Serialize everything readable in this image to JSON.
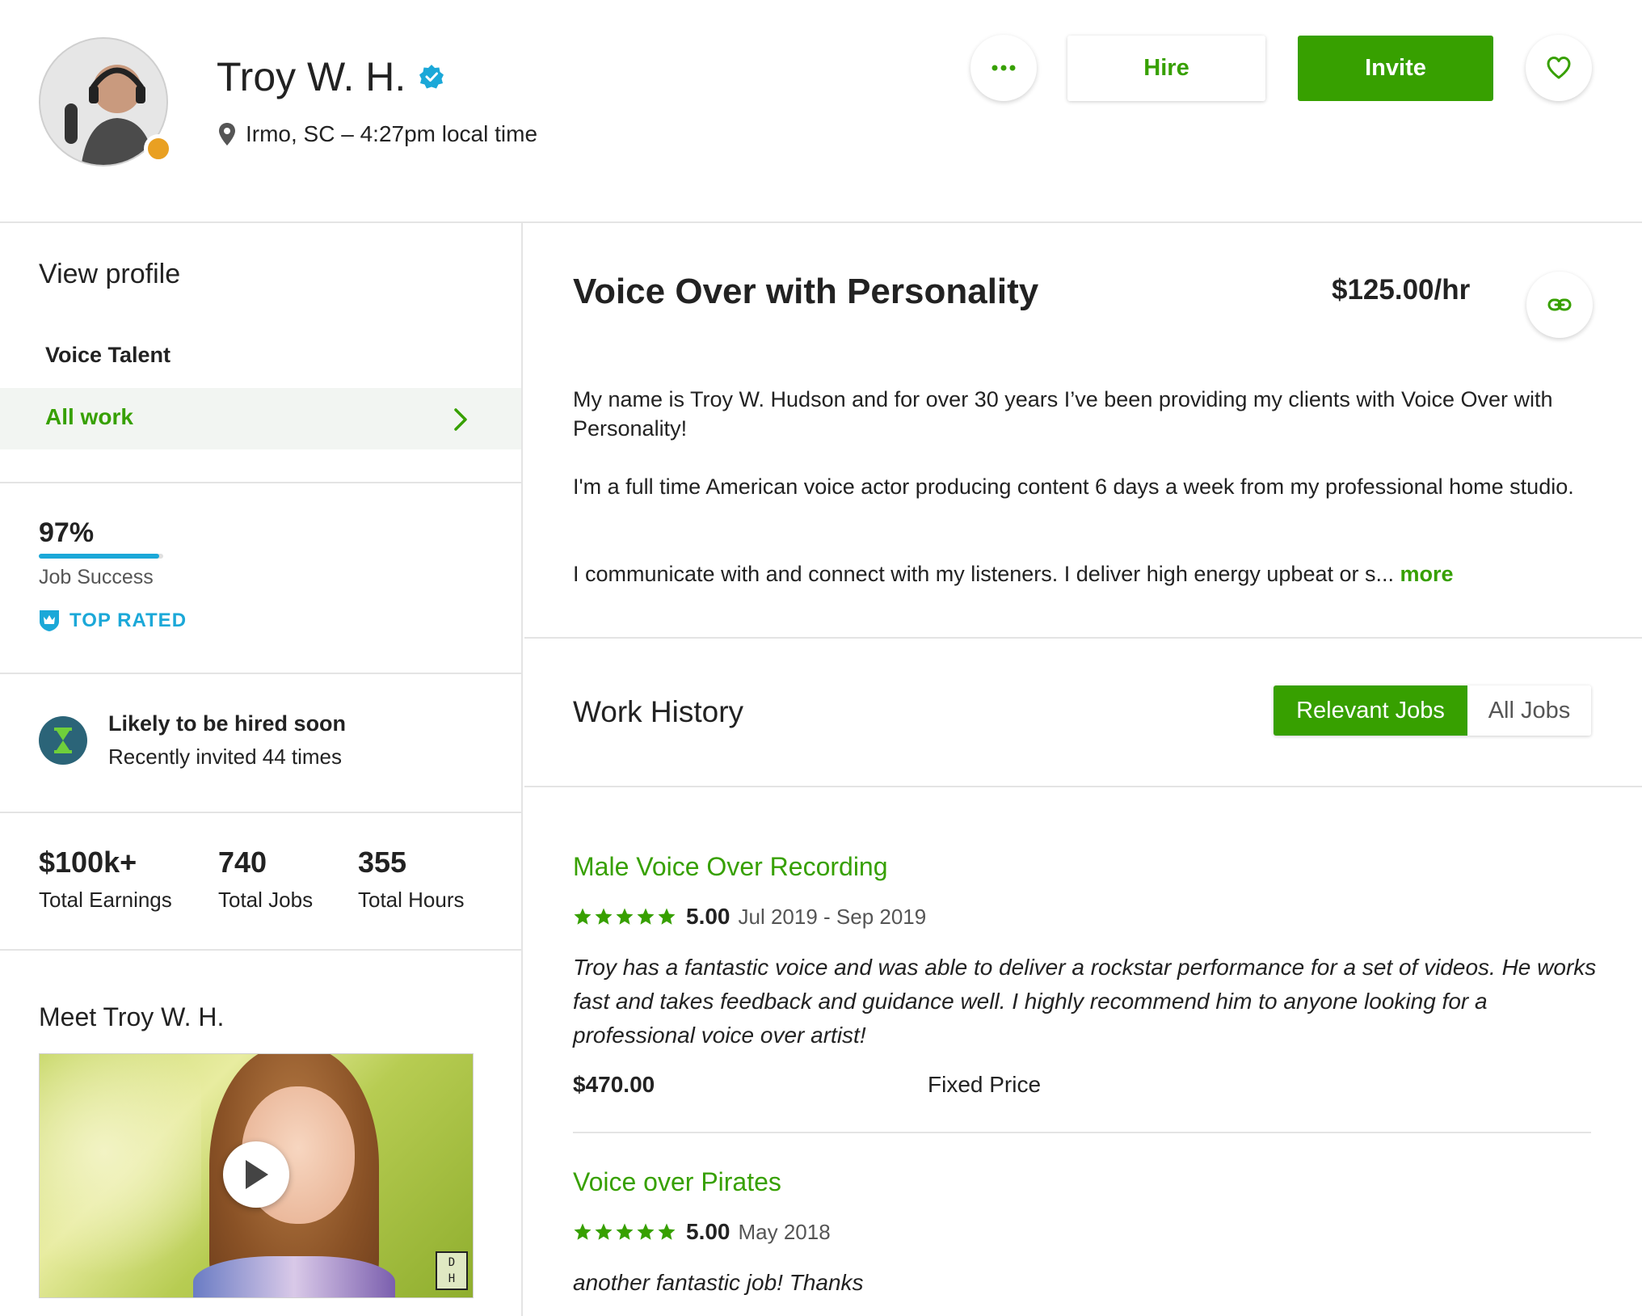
{
  "header": {
    "name": "Troy W. H.",
    "location": "Irmo, SC – 4:27pm local time",
    "hire_label": "Hire",
    "invite_label": "Invite"
  },
  "sidebar": {
    "view_profile": "View profile",
    "category": "Voice Talent",
    "all_work": "All work",
    "job_success_pct": "97%",
    "job_success_value": 0.97,
    "job_success_label": "Job Success",
    "top_rated": "TOP RATED",
    "likely_title": "Likely to be hired soon",
    "likely_sub": "Recently invited 44 times",
    "stats": [
      {
        "value": "$100k+",
        "label": "Total Earnings"
      },
      {
        "value": "740",
        "label": "Total Jobs"
      },
      {
        "value": "355",
        "label": "Total Hours"
      }
    ],
    "meet": "Meet Troy W. H.",
    "video_badge_top": "D",
    "video_badge_bottom": "H"
  },
  "main": {
    "title": "Voice Over with Personality",
    "rate": "$125.00/hr",
    "overview": [
      "My name is Troy W. Hudson and for over 30 years I’ve been providing my clients with Voice Over with Personality!",
      "I'm a full time American voice actor producing content 6 days a week from my professional home studio.",
      "I communicate with and connect with my listeners. I deliver high energy upbeat or s..."
    ],
    "more_label": "more",
    "work_history_title": "Work History",
    "tab_relevant": "Relevant Jobs",
    "tab_all": "All Jobs",
    "jobs": [
      {
        "title": "Male Voice Over Recording",
        "score": "5.00",
        "dates": "Jul 2019 - Sep 2019",
        "review": "Troy has a fantastic voice and was able to deliver a rockstar performance for a set of videos. He works fast and takes feedback and guidance well. I highly recommend him to anyone looking for a professional voice over artist!",
        "amount": "$470.00",
        "type": "Fixed Price"
      },
      {
        "title": "Voice over Pirates",
        "score": "5.00",
        "dates": "May 2018",
        "review": "another fantastic job! Thanks"
      }
    ]
  },
  "colors": {
    "brand_green": "#37a000",
    "top_rated_blue": "#1ba8d8",
    "status_orange": "#e9a022"
  },
  "icons": [
    "verified-badge-icon",
    "location-pin-icon",
    "more-dots-icon",
    "heart-icon",
    "link-icon",
    "chevron-right-icon",
    "top-rated-badge-icon",
    "hourglass-icon",
    "star-icon",
    "play-icon"
  ]
}
